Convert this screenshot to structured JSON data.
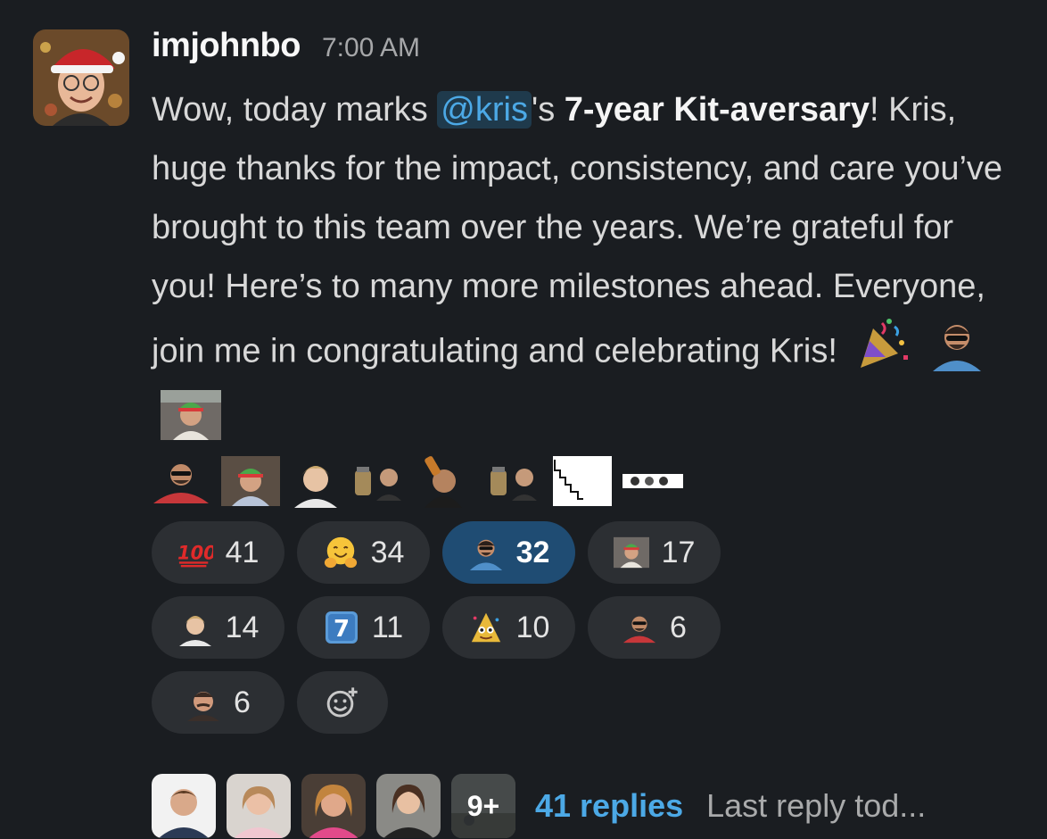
{
  "message": {
    "author": "imjohnbo",
    "time": "7:00 AM",
    "text_part1": "Wow, today marks ",
    "mention": "@kris",
    "text_part2": "'s ",
    "bold": "7-year Kit-aversary",
    "text_part3": "! Kris, huge thanks for the impact, consistency, and care you’ve brought to this team over the years. We’re grateful for you! Here’s to many more milestones ahead. Everyone, join me in congratulating and celebrating Kris!"
  },
  "inline_emojis": [
    "party-popper-icon",
    "custom-person-sunglasses-emoji",
    "custom-person-santa-hat-emoji",
    "custom-person-sunglasses-2-emoji",
    "custom-person-santa-hat-2-emoji",
    "custom-person-blond-emoji",
    "custom-jars-emoji",
    "custom-drinking-emoji",
    "custom-jars-2-emoji",
    "custom-stairs-emoji",
    "custom-group-emoji"
  ],
  "reactions": [
    {
      "emoji": "hundred-points-icon",
      "count": "41",
      "active": false
    },
    {
      "emoji": "hugging-face-icon",
      "count": "34",
      "active": false
    },
    {
      "emoji": "custom-person-sunglasses-emoji",
      "count": "32",
      "active": true
    },
    {
      "emoji": "custom-person-santa-hat-emoji",
      "count": "17",
      "active": false
    },
    {
      "emoji": "custom-person-blond-emoji",
      "count": "14",
      "active": false
    },
    {
      "emoji": "keycap-seven-icon",
      "count": "11",
      "active": false
    },
    {
      "emoji": "custom-party-creature-emoji",
      "count": "10",
      "active": false
    },
    {
      "emoji": "custom-person-sunglasses-2-emoji",
      "count": "6",
      "active": false
    },
    {
      "emoji": "custom-person-mustache-emoji",
      "count": "6",
      "active": false
    }
  ],
  "thread": {
    "more_count": "9+",
    "replies": "41 replies",
    "last_reply": "Last reply tod..."
  },
  "colors": {
    "background": "#1a1d21",
    "reaction_bg": "#2c2f33",
    "reaction_active_bg": "#1f4c73",
    "link": "#4ca9e6"
  }
}
